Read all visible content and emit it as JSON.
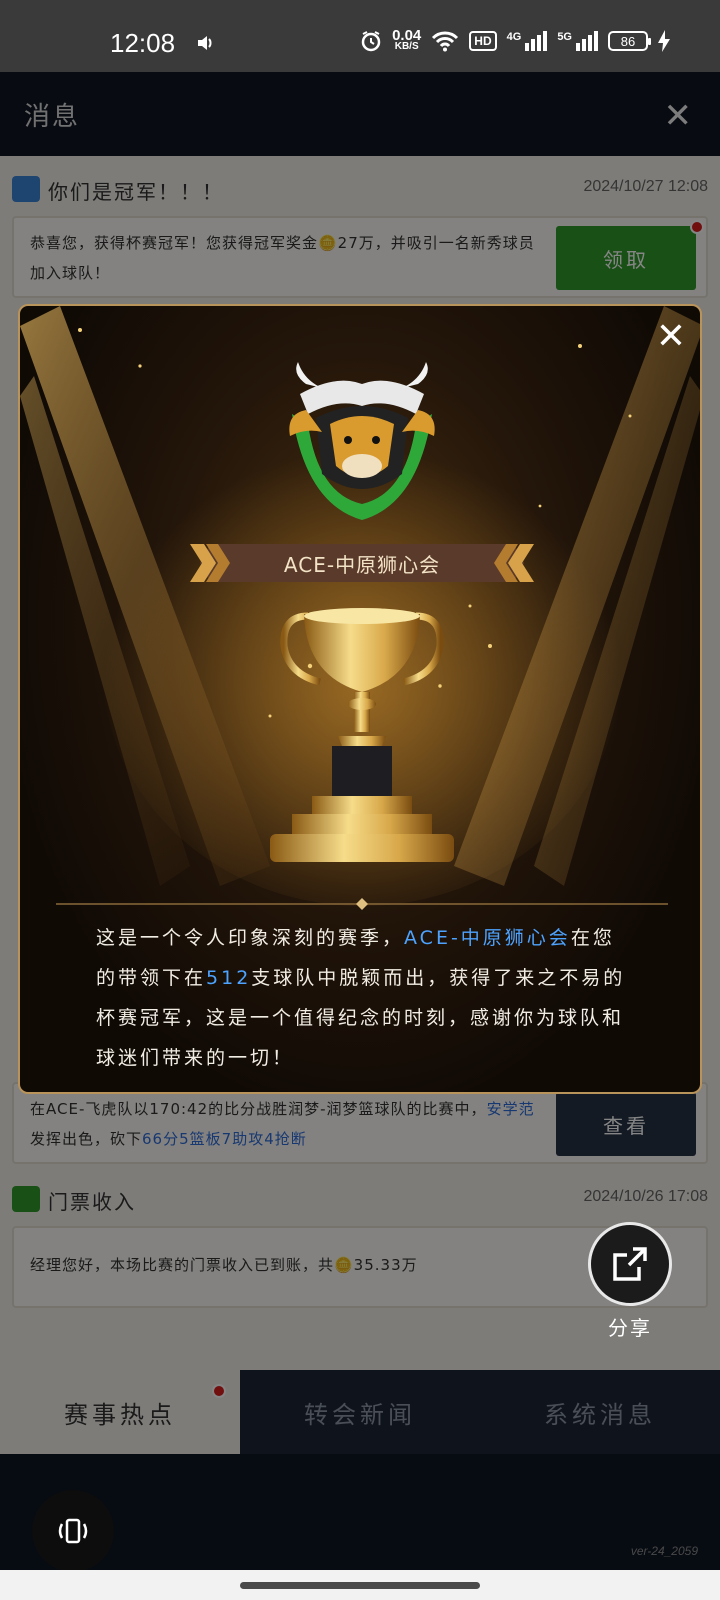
{
  "status": {
    "time": "12:08",
    "speed_value": "0.04",
    "speed_unit": "KB/S",
    "hd_label": "HD",
    "net1": "4G",
    "net2": "5G",
    "battery": "86"
  },
  "header": {
    "title": "消息",
    "close_icon": "close-icon"
  },
  "messages": [
    {
      "title": "你们是冠军！！！",
      "date": "2024/10/27 12:08",
      "body": "恭喜您，获得杯赛冠军！您获得冠军奖金🪙27万，并吸引一名新秀球员加入球队！",
      "button": "领取",
      "button_color": "#2f9a2a"
    },
    {
      "body_pre": "在ACE-飞虎队以170:42的比分战胜润梦-润梦篮球队的比赛中，",
      "body_player": "安学范",
      "body_mid": "发挥出色，砍下",
      "body_stats": "66分5篮板7助攻4抢断",
      "button": "查看"
    },
    {
      "title": "门票收入",
      "date": "2024/10/26 17:08",
      "body": "经理您好，本场比赛的门票收入已到账，共🪙35.33万"
    }
  ],
  "tabs": [
    "赛事热点",
    "转会新闻",
    "系统消息"
  ],
  "version": "ver-24_2059",
  "share_label": "分享",
  "modal": {
    "team_name": "ACE-中原狮心会",
    "story_pre": "这是一个令人印象深刻的赛季，",
    "story_team": "ACE-中原狮心会",
    "story_mid": "在您的带领下在",
    "story_num": "512",
    "story_post": "支球队中脱颖而出，获得了来之不易的杯赛冠军，这是一个值得纪念的时刻，感谢你为球队和球迷们带来的一切！"
  },
  "colors": {
    "accent_blue": "#4da3ff",
    "gold": "#d8a84a",
    "green": "#2f9a2a"
  }
}
